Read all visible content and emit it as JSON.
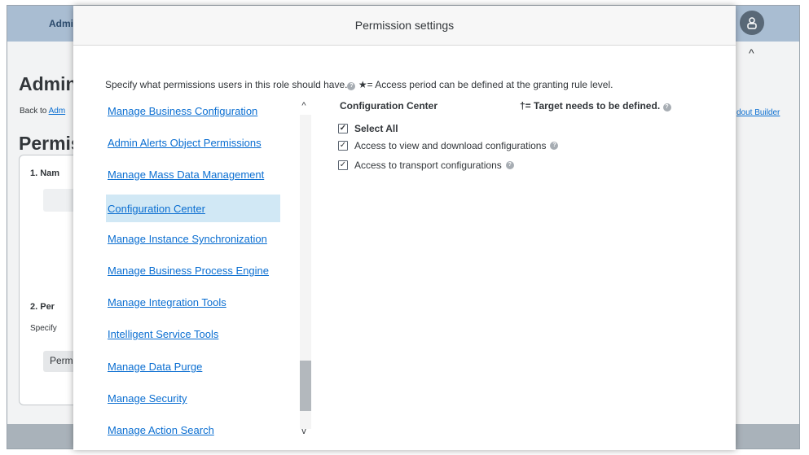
{
  "background": {
    "header_title": "Admi",
    "page_title": "Admin",
    "back_prefix": "Back to",
    "back_link": "Adm",
    "builder_link": "dout Builder",
    "section_title": "Permis",
    "step1_label": "1. Nam",
    "step2_label": "2. Per",
    "specify_text": "Specify",
    "permissions_button": "Perm",
    "chevron": "^"
  },
  "modal": {
    "title": "Permission settings",
    "intro_text": "Specify what permissions users in this role should have.",
    "access_period_note": "★= Access period can be defined at the granting rule level.",
    "list": {
      "items": [
        "Manage Business Configuration",
        "Admin Alerts Object Permissions",
        "Manage Mass Data Management",
        "Configuration Center",
        "Manage Instance Synchronization",
        "Manage Business Process Engine",
        "Manage Integration Tools",
        "Intelligent Service Tools",
        "Manage Data Purge",
        "Manage Security",
        "Manage Action Search"
      ],
      "selected": "Configuration Center",
      "scroll_up": "^",
      "scroll_down": "v"
    },
    "panel": {
      "title": "Configuration Center",
      "target_note": "†= Target needs to be defined.",
      "select_all_label": "Select All",
      "permissions": [
        {
          "label": "Access to view and download configurations",
          "checked": true
        },
        {
          "label": "Access to transport configurations",
          "checked": true
        }
      ],
      "select_all_checked": true
    }
  },
  "colors": {
    "link": "#0a6ed1",
    "selected_row": "#d1e8f5",
    "header_bar": "#a9bdd2"
  }
}
